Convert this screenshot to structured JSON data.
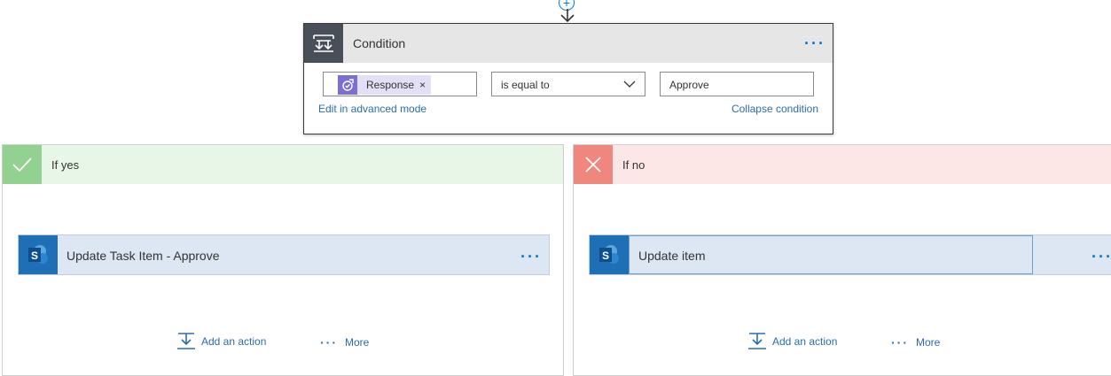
{
  "condition": {
    "title": "Condition",
    "menu_label": "···",
    "left_token": "Response",
    "token_remove": "×",
    "operator": "is equal to",
    "value": "Approve",
    "edit_advanced_link": "Edit in advanced mode",
    "collapse_link": "Collapse condition"
  },
  "connector": {
    "add_label": "+"
  },
  "branches": {
    "yes": {
      "title": "If yes",
      "header_color": "#e8f6e8",
      "badge_color": "#92d18f",
      "action": {
        "title": "Update Task Item - Approve",
        "menu_label": "···"
      },
      "add_action_label": "Add an action",
      "more_label": "More"
    },
    "no": {
      "title": "If no",
      "header_color": "#fde7e6",
      "badge_color": "#f0877f",
      "action": {
        "title": "Update item",
        "menu_label": "···"
      },
      "add_action_label": "Add an action",
      "more_label": "More"
    }
  },
  "colors": {
    "accent": "#0078d4",
    "sharepoint": "#1e6fb5",
    "token": "#7b6fd6"
  },
  "icons": {
    "condition": "condition-icon",
    "token": "approvals-icon",
    "sharepoint": "sharepoint-icon",
    "yes": "checkmark-icon",
    "no": "close-icon",
    "add_action": "add-action-icon",
    "more": "ellipsis-icon",
    "dropdown": "chevron-down-icon"
  }
}
